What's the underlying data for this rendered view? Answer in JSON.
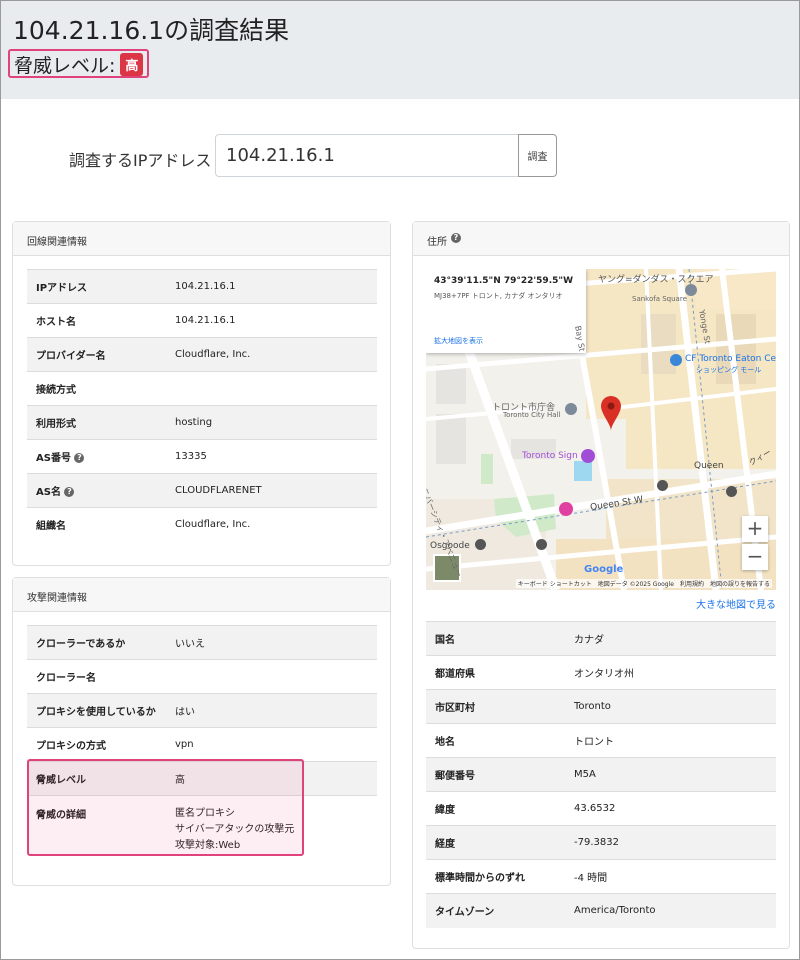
{
  "header": {
    "title": "104.21.16.1の調査結果",
    "threat_label": "脅威レベル:",
    "threat_badge": "高"
  },
  "search": {
    "label": "調査するIPアドレス",
    "value": "104.21.16.1",
    "button": "調査"
  },
  "line_info": {
    "title": "回線関連情報",
    "rows": [
      {
        "key": "IPアドレス",
        "value": "104.21.16.1"
      },
      {
        "key": "ホスト名",
        "value": "104.21.16.1"
      },
      {
        "key": "プロバイダー名",
        "value": "Cloudflare, Inc."
      },
      {
        "key": "接続方式",
        "value": ""
      },
      {
        "key": "利用形式",
        "value": "hosting"
      },
      {
        "key": "AS番号",
        "value": "13335"
      },
      {
        "key": "AS名",
        "value": "CLOUDFLARENET"
      },
      {
        "key": "組織名",
        "value": "Cloudflare, Inc."
      }
    ]
  },
  "attack_info": {
    "title": "攻撃関連情報",
    "rows": [
      {
        "key": "クローラーであるか",
        "value": "いいえ"
      },
      {
        "key": "クローラー名",
        "value": ""
      },
      {
        "key": "プロキシを使用しているか",
        "value": "はい"
      },
      {
        "key": "プロキシの方式",
        "value": "vpn"
      },
      {
        "key": "脅威レベル",
        "value": "高"
      },
      {
        "key": "脅威の詳細",
        "value_lines": [
          "匿名プロキシ",
          "サイバーアタックの攻撃元",
          "攻撃対象:Web"
        ]
      }
    ]
  },
  "address": {
    "title": "住所",
    "map": {
      "coords": "43°39'11.5\"N 79°22'59.5\"W",
      "plus_code": "MJ38+7PF トロント, カナダ オンタリオ",
      "enlarge_link": "拡大地図を表示",
      "labels": {
        "yonge_dundas": "ヤング=ダンダス・スクエア",
        "sankofa": "Sankofa Square",
        "eaton": "CF Toronto Eaton Ce",
        "eaton_sub": "ショッピング モール",
        "city_hall": "トロント市庁舎",
        "city_hall_en": "Toronto City Hall",
        "toronto_sign": "Toronto Sign",
        "queen": "Queen",
        "queen_st": "Queen St W",
        "osgoode": "Osgoode",
        "university": "ユニバーシティ・アベニュー",
        "bay_st": "Bay St",
        "yonge_st": "Yonge St",
        "queen_right": "クィー",
        "google": "Google"
      },
      "zoom_in": "+",
      "zoom_out": "−",
      "attribution": [
        "キーボード ショートカット",
        "地図データ ©2025 Google",
        "利用規約",
        "地図の誤りを報告する"
      ]
    },
    "big_map_link": "大きな地図で見る",
    "rows": [
      {
        "key": "国名",
        "value": "カナダ"
      },
      {
        "key": "都道府県",
        "value": "オンタリオ州"
      },
      {
        "key": "市区町村",
        "value": "Toronto"
      },
      {
        "key": "地名",
        "value": "トロント"
      },
      {
        "key": "郵便番号",
        "value": "M5A"
      },
      {
        "key": "緯度",
        "value": "43.6532"
      },
      {
        "key": "経度",
        "value": "-79.3832"
      },
      {
        "key": "標準時間からのずれ",
        "value": "-4 時間"
      },
      {
        "key": "タイムゾーン",
        "value": "America/Toronto"
      }
    ]
  }
}
